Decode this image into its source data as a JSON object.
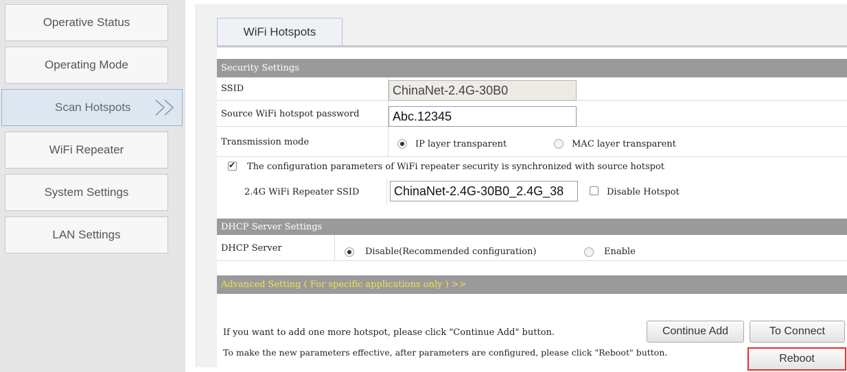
{
  "sidebar": {
    "items": [
      {
        "label": "Operative Status"
      },
      {
        "label": "Operating Mode"
      },
      {
        "label": "Scan Hotspots"
      },
      {
        "label": "WiFi Repeater"
      },
      {
        "label": "System Settings"
      },
      {
        "label": "LAN Settings"
      }
    ],
    "active_index": 2
  },
  "tabs": [
    {
      "label": "WiFi Hotspots"
    }
  ],
  "security": {
    "header": "Security Settings",
    "ssid_label": "SSID",
    "ssid_value": "ChinaNet-2.4G-30B0",
    "password_label": "Source WiFi hotspot password",
    "password_value": "Abc.12345",
    "transmission_label": "Transmission mode",
    "option_ip": "IP layer transparent",
    "option_mac": "MAC layer transparent",
    "sync_text": "The configuration parameters of WiFi repeater security is synchronized with source hotspot",
    "repeater_ssid_label": "2.4G WiFi Repeater SSID",
    "repeater_ssid_value": "ChinaNet-2.4G-30B0_2.4G_38",
    "disable_hotspot_label": "Disable Hotspot"
  },
  "dhcp": {
    "header": "DHCP Server Settings",
    "label": "DHCP Server",
    "option_disable": "Disable(Recommended configuration)",
    "option_enable": "Enable"
  },
  "advanced": {
    "label": "Advanced Setting ( For specific applications only ) >>"
  },
  "footer": {
    "add_text": "If you want to add one more hotspot, please click \"Continue Add\" button.",
    "continue_add": "Continue Add",
    "to_connect": "To Connect",
    "reboot_text": "To make the new parameters effective, after parameters are configured, please click \"Reboot\" button.",
    "reboot": "Reboot"
  },
  "colors": {
    "section_header": "#9a9a9a",
    "advanced_text": "#f5e14a",
    "reboot_highlight": "#e0302a",
    "active_nav": "#dde7f2"
  },
  "icons": {
    "active_nav_indicator": "double-chevron-right-icon"
  }
}
